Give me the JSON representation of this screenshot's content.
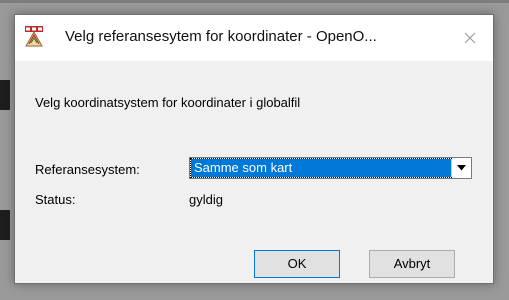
{
  "window": {
    "title": "Velg referansesytem for koordinater - OpenO...",
    "app_icon": "openorienteering-mapper-icon",
    "close_icon": "close-icon"
  },
  "dialog": {
    "instruction": "Velg koordinatsystem for koordinater i globalfil",
    "reference_label": "Referansesystem:",
    "reference_value": "Samme som kart",
    "status_label": "Status:",
    "status_value": "gyldig",
    "ok_label": "OK",
    "cancel_label": "Avbryt"
  },
  "colors": {
    "selection": "#0078d7",
    "dialog_bg": "#f0f0f0",
    "titlebar_bg": "#ffffff"
  }
}
